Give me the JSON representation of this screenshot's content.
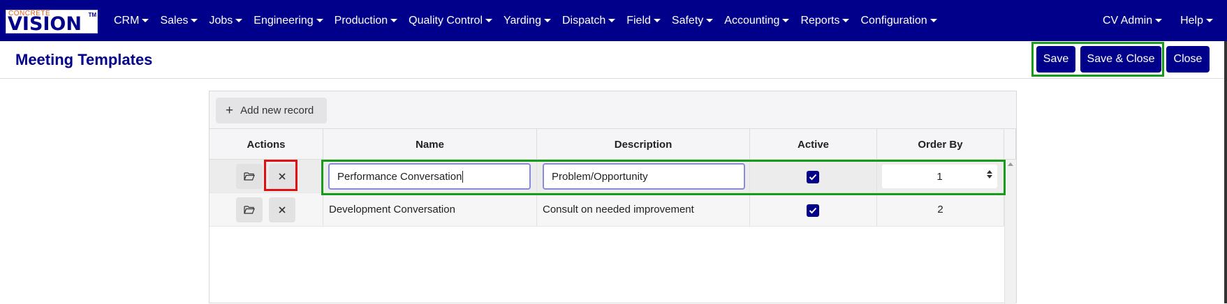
{
  "logo": {
    "top_text": "CONCRETE",
    "main_text": "VISION",
    "tm": "TM"
  },
  "nav": {
    "items": [
      "CRM",
      "Sales",
      "Jobs",
      "Engineering",
      "Production",
      "Quality Control",
      "Yarding",
      "Dispatch",
      "Field",
      "Safety",
      "Accounting",
      "Reports",
      "Configuration"
    ],
    "right_items": [
      "CV Admin",
      "Help"
    ]
  },
  "header": {
    "title": "Meeting Templates",
    "save_label": "Save",
    "save_close_label": "Save & Close",
    "close_label": "Close"
  },
  "grid": {
    "add_label": "Add new record",
    "columns": [
      "Actions",
      "Name",
      "Description",
      "Active",
      "Order By"
    ],
    "rows": [
      {
        "name": "Performance Conversation",
        "description": "Problem/Opportunity",
        "active": true,
        "order_by": "1",
        "editing": true
      },
      {
        "name": "Development Conversation",
        "description": "Consult on needed improvement",
        "active": true,
        "order_by": "2",
        "editing": false
      }
    ]
  },
  "colors": {
    "brand": "#00008b",
    "highlight_green": "#1a9a1a",
    "highlight_red": "#e01010"
  }
}
